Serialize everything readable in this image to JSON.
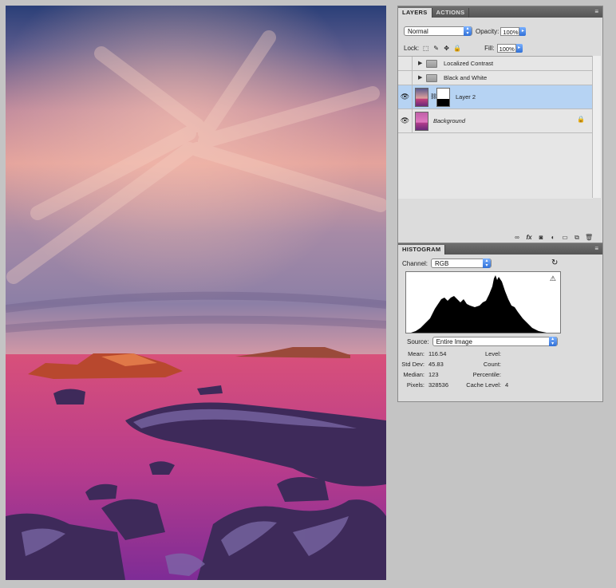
{
  "layers_panel": {
    "tabs": [
      "LAYERS",
      "ACTIONS"
    ],
    "blend_mode": "Normal",
    "opacity_label": "Opacity:",
    "opacity_value": "100%",
    "lock_label": "Lock:",
    "fill_label": "Fill:",
    "fill_value": "100%",
    "layers": [
      {
        "name": "Localized Contrast",
        "type": "group",
        "visible": false
      },
      {
        "name": "Black and White",
        "type": "group",
        "visible": false
      },
      {
        "name": "Layer 2",
        "type": "pixel-with-mask",
        "visible": true,
        "selected": true
      },
      {
        "name": "Background",
        "type": "background",
        "visible": true,
        "locked": true
      }
    ],
    "footer_icons": [
      "link-icon",
      "fx-icon",
      "mask-icon",
      "adjustment-icon",
      "group-icon",
      "new-layer-icon",
      "trash-icon"
    ]
  },
  "histogram_panel": {
    "tab": "HISTOGRAM",
    "channel_label": "Channel:",
    "channel_value": "RGB",
    "source_label": "Source:",
    "source_value": "Entire Image",
    "stats_left": [
      {
        "label": "Mean:",
        "value": "116.54"
      },
      {
        "label": "Std Dev:",
        "value": "45.83"
      },
      {
        "label": "Median:",
        "value": "123"
      },
      {
        "label": "Pixels:",
        "value": "328536"
      }
    ],
    "stats_right": [
      {
        "label": "Level:",
        "value": ""
      },
      {
        "label": "Count:",
        "value": ""
      },
      {
        "label": "Percentile:",
        "value": ""
      },
      {
        "label": "Cache Level:",
        "value": "4"
      }
    ]
  },
  "colors": {
    "selected_layer": "#b6d3f3",
    "panel_bg": "#dcdcdc",
    "canvas_backdrop": "#c4c4c4"
  }
}
